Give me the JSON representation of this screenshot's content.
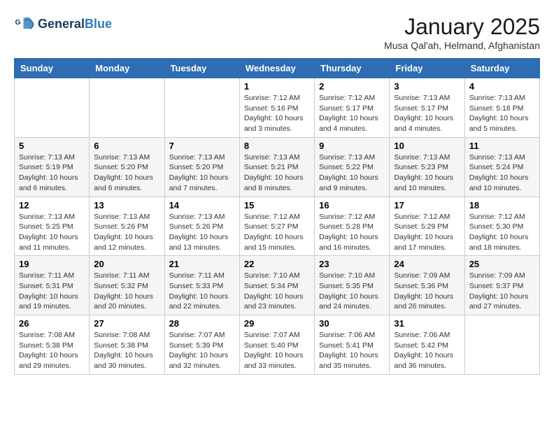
{
  "header": {
    "logo_line1": "General",
    "logo_line2": "Blue",
    "month_title": "January 2025",
    "subtitle": "Musa Qal'ah, Helmand, Afghanistan"
  },
  "weekdays": [
    "Sunday",
    "Monday",
    "Tuesday",
    "Wednesday",
    "Thursday",
    "Friday",
    "Saturday"
  ],
  "weeks": [
    [
      {
        "day": "",
        "info": ""
      },
      {
        "day": "",
        "info": ""
      },
      {
        "day": "",
        "info": ""
      },
      {
        "day": "1",
        "info": "Sunrise: 7:12 AM\nSunset: 5:16 PM\nDaylight: 10 hours\nand 3 minutes."
      },
      {
        "day": "2",
        "info": "Sunrise: 7:12 AM\nSunset: 5:17 PM\nDaylight: 10 hours\nand 4 minutes."
      },
      {
        "day": "3",
        "info": "Sunrise: 7:13 AM\nSunset: 5:17 PM\nDaylight: 10 hours\nand 4 minutes."
      },
      {
        "day": "4",
        "info": "Sunrise: 7:13 AM\nSunset: 5:18 PM\nDaylight: 10 hours\nand 5 minutes."
      }
    ],
    [
      {
        "day": "5",
        "info": "Sunrise: 7:13 AM\nSunset: 5:19 PM\nDaylight: 10 hours\nand 6 minutes."
      },
      {
        "day": "6",
        "info": "Sunrise: 7:13 AM\nSunset: 5:20 PM\nDaylight: 10 hours\nand 6 minutes."
      },
      {
        "day": "7",
        "info": "Sunrise: 7:13 AM\nSunset: 5:20 PM\nDaylight: 10 hours\nand 7 minutes."
      },
      {
        "day": "8",
        "info": "Sunrise: 7:13 AM\nSunset: 5:21 PM\nDaylight: 10 hours\nand 8 minutes."
      },
      {
        "day": "9",
        "info": "Sunrise: 7:13 AM\nSunset: 5:22 PM\nDaylight: 10 hours\nand 9 minutes."
      },
      {
        "day": "10",
        "info": "Sunrise: 7:13 AM\nSunset: 5:23 PM\nDaylight: 10 hours\nand 10 minutes."
      },
      {
        "day": "11",
        "info": "Sunrise: 7:13 AM\nSunset: 5:24 PM\nDaylight: 10 hours\nand 10 minutes."
      }
    ],
    [
      {
        "day": "12",
        "info": "Sunrise: 7:13 AM\nSunset: 5:25 PM\nDaylight: 10 hours\nand 11 minutes."
      },
      {
        "day": "13",
        "info": "Sunrise: 7:13 AM\nSunset: 5:26 PM\nDaylight: 10 hours\nand 12 minutes."
      },
      {
        "day": "14",
        "info": "Sunrise: 7:13 AM\nSunset: 5:26 PM\nDaylight: 10 hours\nand 13 minutes."
      },
      {
        "day": "15",
        "info": "Sunrise: 7:12 AM\nSunset: 5:27 PM\nDaylight: 10 hours\nand 15 minutes."
      },
      {
        "day": "16",
        "info": "Sunrise: 7:12 AM\nSunset: 5:28 PM\nDaylight: 10 hours\nand 16 minutes."
      },
      {
        "day": "17",
        "info": "Sunrise: 7:12 AM\nSunset: 5:29 PM\nDaylight: 10 hours\nand 17 minutes."
      },
      {
        "day": "18",
        "info": "Sunrise: 7:12 AM\nSunset: 5:30 PM\nDaylight: 10 hours\nand 18 minutes."
      }
    ],
    [
      {
        "day": "19",
        "info": "Sunrise: 7:11 AM\nSunset: 5:31 PM\nDaylight: 10 hours\nand 19 minutes."
      },
      {
        "day": "20",
        "info": "Sunrise: 7:11 AM\nSunset: 5:32 PM\nDaylight: 10 hours\nand 20 minutes."
      },
      {
        "day": "21",
        "info": "Sunrise: 7:11 AM\nSunset: 5:33 PM\nDaylight: 10 hours\nand 22 minutes."
      },
      {
        "day": "22",
        "info": "Sunrise: 7:10 AM\nSunset: 5:34 PM\nDaylight: 10 hours\nand 23 minutes."
      },
      {
        "day": "23",
        "info": "Sunrise: 7:10 AM\nSunset: 5:35 PM\nDaylight: 10 hours\nand 24 minutes."
      },
      {
        "day": "24",
        "info": "Sunrise: 7:09 AM\nSunset: 5:36 PM\nDaylight: 10 hours\nand 26 minutes."
      },
      {
        "day": "25",
        "info": "Sunrise: 7:09 AM\nSunset: 5:37 PM\nDaylight: 10 hours\nand 27 minutes."
      }
    ],
    [
      {
        "day": "26",
        "info": "Sunrise: 7:08 AM\nSunset: 5:38 PM\nDaylight: 10 hours\nand 29 minutes."
      },
      {
        "day": "27",
        "info": "Sunrise: 7:08 AM\nSunset: 5:38 PM\nDaylight: 10 hours\nand 30 minutes."
      },
      {
        "day": "28",
        "info": "Sunrise: 7:07 AM\nSunset: 5:39 PM\nDaylight: 10 hours\nand 32 minutes."
      },
      {
        "day": "29",
        "info": "Sunrise: 7:07 AM\nSunset: 5:40 PM\nDaylight: 10 hours\nand 33 minutes."
      },
      {
        "day": "30",
        "info": "Sunrise: 7:06 AM\nSunset: 5:41 PM\nDaylight: 10 hours\nand 35 minutes."
      },
      {
        "day": "31",
        "info": "Sunrise: 7:06 AM\nSunset: 5:42 PM\nDaylight: 10 hours\nand 36 minutes."
      },
      {
        "day": "",
        "info": ""
      }
    ]
  ]
}
